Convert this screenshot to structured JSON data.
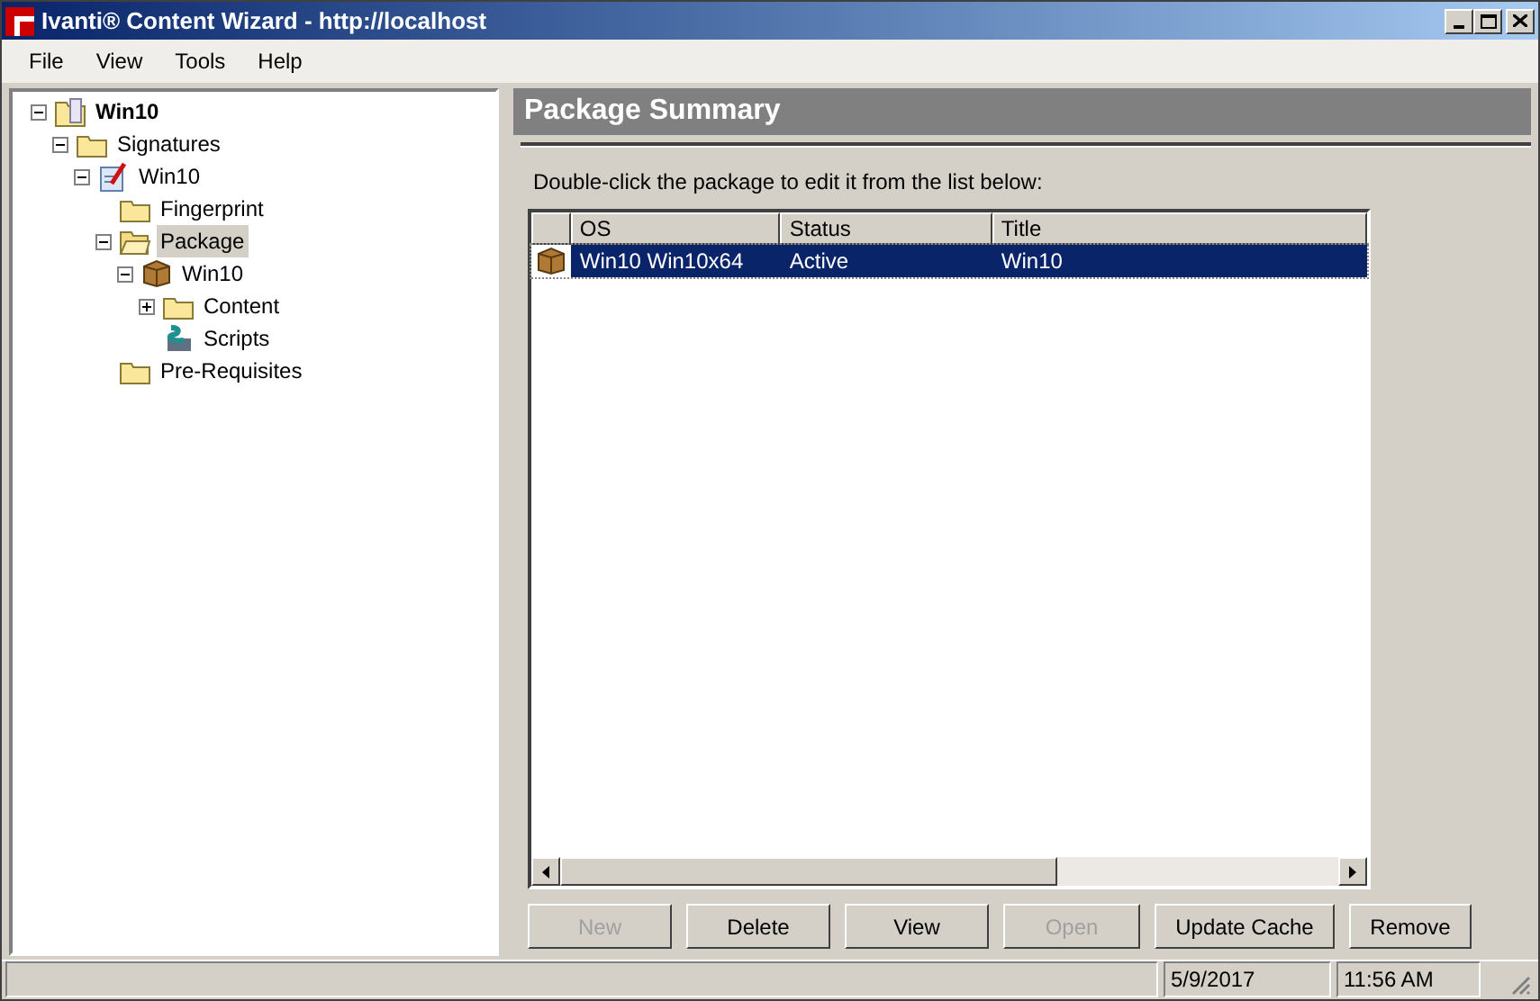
{
  "window": {
    "title": "Ivanti® Content Wizard - http://localhost"
  },
  "menu": [
    "File",
    "View",
    "Tools",
    "Help"
  ],
  "tree": [
    {
      "label": "Win10",
      "kind": "root",
      "bold": true,
      "expanded": true,
      "selected": false,
      "children": [
        {
          "label": "Signatures",
          "kind": "folder",
          "expanded": true,
          "selected": false,
          "children": [
            {
              "label": "Win10",
              "kind": "signature",
              "expanded": true,
              "selected": false,
              "children": [
                {
                  "label": "Fingerprint",
                  "kind": "folder",
                  "selected": false
                },
                {
                  "label": "Package",
                  "kind": "folder-open",
                  "expanded": true,
                  "selected": true,
                  "children": [
                    {
                      "label": "Win10",
                      "kind": "package",
                      "expanded": true,
                      "selected": false,
                      "children": [
                        {
                          "label": "Content",
                          "kind": "folder",
                          "expanded": false,
                          "selected": false
                        },
                        {
                          "label": "Scripts",
                          "kind": "scripts",
                          "selected": false
                        }
                      ]
                    }
                  ]
                },
                {
                  "label": "Pre-Requisites",
                  "kind": "folder",
                  "selected": false
                }
              ]
            }
          ]
        }
      ]
    }
  ],
  "panel": {
    "title": "Package Summary",
    "instruction": "Double-click the package to edit it from the list below:"
  },
  "table": {
    "columns": [
      "OS",
      "Status",
      "Title"
    ],
    "rows": [
      {
        "cells": [
          "Win10 Win10x64",
          "Active",
          "Win10"
        ],
        "selected": true
      }
    ]
  },
  "buttons": [
    {
      "label": "New",
      "disabled": true
    },
    {
      "label": "Delete",
      "disabled": false
    },
    {
      "label": "View",
      "disabled": false
    },
    {
      "label": "Open",
      "disabled": true
    },
    {
      "label": "Update Cache",
      "disabled": false
    },
    {
      "label": "Remove",
      "disabled": false
    }
  ],
  "status_bar": {
    "date": "5/9/2017",
    "time": "11:56 AM"
  }
}
